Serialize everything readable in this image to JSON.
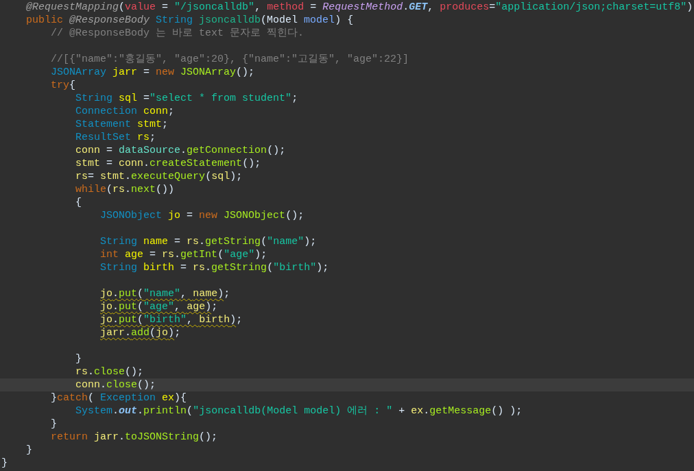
{
  "editor": {
    "lines": [
      {
        "kind": "code",
        "tokens": [
          {
            "text": "\t@RequestMapping",
            "kind": "ann"
          },
          {
            "text": "(",
            "kind": "plain"
          },
          {
            "text": "value",
            "kind": "attr"
          },
          {
            "text": " = ",
            "kind": "plain"
          },
          {
            "text": "\"/jsoncalldb\"",
            "kind": "str"
          },
          {
            "text": ", ",
            "kind": "plain"
          },
          {
            "text": "method",
            "kind": "attr"
          },
          {
            "text": " = ",
            "kind": "plain"
          },
          {
            "text": "RequestMethod",
            "kind": "enum"
          },
          {
            "text": ".",
            "kind": "plain"
          },
          {
            "text": "GET",
            "kind": "const"
          },
          {
            "text": ", ",
            "kind": "plain"
          },
          {
            "text": "produces",
            "kind": "attr"
          },
          {
            "text": "=",
            "kind": "plain"
          },
          {
            "text": "\"application/json;charset=utf8\"",
            "kind": "str"
          },
          {
            "text": ")",
            "kind": "plain"
          }
        ]
      },
      {
        "kind": "code",
        "tokens": [
          {
            "text": "\tpublic ",
            "kind": "kw"
          },
          {
            "text": "@ResponseBody ",
            "kind": "ann"
          },
          {
            "text": "String ",
            "kind": "type"
          },
          {
            "text": "jsoncalldb",
            "kind": "fn"
          },
          {
            "text": "(Model ",
            "kind": "plain"
          },
          {
            "text": "model",
            "kind": "param"
          },
          {
            "text": ") {",
            "kind": "plain"
          }
        ]
      },
      {
        "kind": "code",
        "tokens": [
          {
            "text": "\t\t// @ResponseBody 는 바로 text 문자로 찍힌다.",
            "kind": "cmt"
          }
        ]
      },
      {
        "kind": "blank"
      },
      {
        "kind": "code",
        "tokens": [
          {
            "text": "\t\t//[{\"name\":\"홍길동\", \"age\":20}, {\"name\":\"고길동\", \"age\":22}]",
            "kind": "cmt"
          }
        ]
      },
      {
        "kind": "code",
        "tokens": [
          {
            "text": "\t\tJSONArray ",
            "kind": "type"
          },
          {
            "text": "jarr",
            "kind": "decl"
          },
          {
            "text": " = ",
            "kind": "plain"
          },
          {
            "text": "new ",
            "kind": "kw"
          },
          {
            "text": "JSONArray",
            "kind": "method"
          },
          {
            "text": "();",
            "kind": "plain"
          }
        ]
      },
      {
        "kind": "code",
        "tokens": [
          {
            "text": "\t\ttry",
            "kind": "kw"
          },
          {
            "text": "{",
            "kind": "plain"
          }
        ]
      },
      {
        "kind": "code",
        "tokens": [
          {
            "text": "\t\t\tString ",
            "kind": "type"
          },
          {
            "text": "sql",
            "kind": "decl"
          },
          {
            "text": " =",
            "kind": "plain"
          },
          {
            "text": "\"select * from student\"",
            "kind": "str"
          },
          {
            "text": ";",
            "kind": "plain"
          }
        ]
      },
      {
        "kind": "code",
        "tokens": [
          {
            "text": "\t\t\tConnection ",
            "kind": "type"
          },
          {
            "text": "conn",
            "kind": "decl"
          },
          {
            "text": ";",
            "kind": "plain"
          }
        ]
      },
      {
        "kind": "code",
        "tokens": [
          {
            "text": "\t\t\tStatement ",
            "kind": "type"
          },
          {
            "text": "stmt",
            "kind": "decl"
          },
          {
            "text": ";",
            "kind": "plain"
          }
        ]
      },
      {
        "kind": "code",
        "tokens": [
          {
            "text": "\t\t\tResultSet ",
            "kind": "type"
          },
          {
            "text": "rs",
            "kind": "decl"
          },
          {
            "text": ";",
            "kind": "plain"
          }
        ]
      },
      {
        "kind": "code",
        "tokens": [
          {
            "text": "\t\t\tconn",
            "kind": "var"
          },
          {
            "text": " = ",
            "kind": "plain"
          },
          {
            "text": "dataSource",
            "kind": "field"
          },
          {
            "text": ".",
            "kind": "plain"
          },
          {
            "text": "getConnection",
            "kind": "method"
          },
          {
            "text": "();",
            "kind": "plain"
          }
        ]
      },
      {
        "kind": "code",
        "tokens": [
          {
            "text": "\t\t\tstmt",
            "kind": "var"
          },
          {
            "text": " = ",
            "kind": "plain"
          },
          {
            "text": "conn",
            "kind": "var"
          },
          {
            "text": ".",
            "kind": "plain"
          },
          {
            "text": "createStatement",
            "kind": "method"
          },
          {
            "text": "();",
            "kind": "plain"
          }
        ]
      },
      {
        "kind": "code",
        "tokens": [
          {
            "text": "\t\t\trs",
            "kind": "var"
          },
          {
            "text": "= ",
            "kind": "plain"
          },
          {
            "text": "stmt",
            "kind": "var"
          },
          {
            "text": ".",
            "kind": "plain"
          },
          {
            "text": "executeQuery",
            "kind": "method"
          },
          {
            "text": "(",
            "kind": "plain"
          },
          {
            "text": "sql",
            "kind": "var"
          },
          {
            "text": ");",
            "kind": "plain"
          }
        ]
      },
      {
        "kind": "code",
        "tokens": [
          {
            "text": "\t\t\twhile",
            "kind": "kw"
          },
          {
            "text": "(",
            "kind": "plain"
          },
          {
            "text": "rs",
            "kind": "var"
          },
          {
            "text": ".",
            "kind": "plain"
          },
          {
            "text": "next",
            "kind": "method"
          },
          {
            "text": "())",
            "kind": "plain"
          }
        ]
      },
      {
        "kind": "code",
        "tokens": [
          {
            "text": "\t\t\t{",
            "kind": "plain"
          }
        ]
      },
      {
        "kind": "code",
        "tokens": [
          {
            "text": "\t\t\t\tJSONObject ",
            "kind": "type"
          },
          {
            "text": "jo",
            "kind": "decl"
          },
          {
            "text": " = ",
            "kind": "plain"
          },
          {
            "text": "new ",
            "kind": "kw"
          },
          {
            "text": "JSONObject",
            "kind": "method"
          },
          {
            "text": "();",
            "kind": "plain"
          }
        ]
      },
      {
        "kind": "blank"
      },
      {
        "kind": "code",
        "tokens": [
          {
            "text": "\t\t\t\tString ",
            "kind": "type"
          },
          {
            "text": "name",
            "kind": "decl"
          },
          {
            "text": " = ",
            "kind": "plain"
          },
          {
            "text": "rs",
            "kind": "var"
          },
          {
            "text": ".",
            "kind": "plain"
          },
          {
            "text": "getString",
            "kind": "method"
          },
          {
            "text": "(",
            "kind": "plain"
          },
          {
            "text": "\"name\"",
            "kind": "str"
          },
          {
            "text": ");",
            "kind": "plain"
          }
        ]
      },
      {
        "kind": "code",
        "tokens": [
          {
            "text": "\t\t\t\tint ",
            "kind": "kw"
          },
          {
            "text": "age",
            "kind": "decl"
          },
          {
            "text": " = ",
            "kind": "plain"
          },
          {
            "text": "rs",
            "kind": "var"
          },
          {
            "text": ".",
            "kind": "plain"
          },
          {
            "text": "getInt",
            "kind": "method"
          },
          {
            "text": "(",
            "kind": "plain"
          },
          {
            "text": "\"age\"",
            "kind": "str"
          },
          {
            "text": ");",
            "kind": "plain"
          }
        ]
      },
      {
        "kind": "code",
        "tokens": [
          {
            "text": "\t\t\t\tString ",
            "kind": "type"
          },
          {
            "text": "birth",
            "kind": "decl"
          },
          {
            "text": " = ",
            "kind": "plain"
          },
          {
            "text": "rs",
            "kind": "var"
          },
          {
            "text": ".",
            "kind": "plain"
          },
          {
            "text": "getString",
            "kind": "method"
          },
          {
            "text": "(",
            "kind": "plain"
          },
          {
            "text": "\"birth\"",
            "kind": "str"
          },
          {
            "text": ");",
            "kind": "plain"
          }
        ]
      },
      {
        "kind": "blank"
      },
      {
        "kind": "warning",
        "tokens": [
          {
            "text": "\t\t\t\tjo",
            "kind": "var"
          },
          {
            "text": ".",
            "kind": "plain"
          },
          {
            "text": "put",
            "kind": "method"
          },
          {
            "text": "(",
            "kind": "plain"
          },
          {
            "text": "\"name\"",
            "kind": "str"
          },
          {
            "text": ", ",
            "kind": "plain"
          },
          {
            "text": "name",
            "kind": "var"
          },
          {
            "text": ")",
            "kind": "plain"
          },
          {
            "text": ";",
            "kind": "plain"
          }
        ]
      },
      {
        "kind": "warning",
        "tokens": [
          {
            "text": "\t\t\t\tjo",
            "kind": "var"
          },
          {
            "text": ".",
            "kind": "plain"
          },
          {
            "text": "put",
            "kind": "method"
          },
          {
            "text": "(",
            "kind": "plain"
          },
          {
            "text": "\"age\"",
            "kind": "str"
          },
          {
            "text": ", ",
            "kind": "plain"
          },
          {
            "text": "age",
            "kind": "var"
          },
          {
            "text": ")",
            "kind": "plain"
          },
          {
            "text": ";",
            "kind": "plain"
          }
        ]
      },
      {
        "kind": "warning",
        "tokens": [
          {
            "text": "\t\t\t\tjo",
            "kind": "var"
          },
          {
            "text": ".",
            "kind": "plain"
          },
          {
            "text": "put",
            "kind": "method"
          },
          {
            "text": "(",
            "kind": "plain"
          },
          {
            "text": "\"birth\"",
            "kind": "str"
          },
          {
            "text": ", ",
            "kind": "plain"
          },
          {
            "text": "birth",
            "kind": "var"
          },
          {
            "text": ")",
            "kind": "plain"
          },
          {
            "text": ";",
            "kind": "plain"
          }
        ]
      },
      {
        "kind": "warning",
        "tokens": [
          {
            "text": "\t\t\t\tjarr",
            "kind": "var"
          },
          {
            "text": ".",
            "kind": "plain"
          },
          {
            "text": "add",
            "kind": "method"
          },
          {
            "text": "(",
            "kind": "plain"
          },
          {
            "text": "jo",
            "kind": "var"
          },
          {
            "text": ")",
            "kind": "plain"
          },
          {
            "text": ";",
            "kind": "plain"
          }
        ]
      },
      {
        "kind": "blank"
      },
      {
        "kind": "code",
        "tokens": [
          {
            "text": "\t\t\t}",
            "kind": "plain"
          }
        ]
      },
      {
        "kind": "code",
        "tokens": [
          {
            "text": "\t\t\trs",
            "kind": "var"
          },
          {
            "text": ".",
            "kind": "plain"
          },
          {
            "text": "close",
            "kind": "method"
          },
          {
            "text": "();",
            "kind": "plain"
          }
        ]
      },
      {
        "kind": "current",
        "tokens": [
          {
            "text": "\t\t\tconn",
            "kind": "var"
          },
          {
            "text": ".",
            "kind": "plain"
          },
          {
            "text": "close",
            "kind": "method"
          },
          {
            "text": "();",
            "kind": "plain"
          }
        ]
      },
      {
        "kind": "code",
        "tokens": [
          {
            "text": "\t\t}",
            "kind": "plain"
          },
          {
            "text": "catch",
            "kind": "kw"
          },
          {
            "text": "( ",
            "kind": "plain"
          },
          {
            "text": "Exception ",
            "kind": "type"
          },
          {
            "text": "ex",
            "kind": "decl"
          },
          {
            "text": "){",
            "kind": "plain"
          }
        ]
      },
      {
        "kind": "code",
        "tokens": [
          {
            "text": "\t\t\tSystem",
            "kind": "type"
          },
          {
            "text": ".",
            "kind": "plain"
          },
          {
            "text": "out",
            "kind": "const"
          },
          {
            "text": ".",
            "kind": "plain"
          },
          {
            "text": "println",
            "kind": "method"
          },
          {
            "text": "(",
            "kind": "plain"
          },
          {
            "text": "\"jsoncalldb(Model model) 에러 : \"",
            "kind": "str"
          },
          {
            "text": " + ",
            "kind": "plain"
          },
          {
            "text": "ex",
            "kind": "var"
          },
          {
            "text": ".",
            "kind": "plain"
          },
          {
            "text": "getMessage",
            "kind": "method"
          },
          {
            "text": "() );",
            "kind": "plain"
          }
        ]
      },
      {
        "kind": "code",
        "tokens": [
          {
            "text": "\t\t}",
            "kind": "plain"
          }
        ]
      },
      {
        "kind": "code",
        "tokens": [
          {
            "text": "\t\treturn ",
            "kind": "kw"
          },
          {
            "text": "jarr",
            "kind": "var"
          },
          {
            "text": ".",
            "kind": "plain"
          },
          {
            "text": "toJSONString",
            "kind": "method"
          },
          {
            "text": "();",
            "kind": "plain"
          }
        ]
      },
      {
        "kind": "code",
        "tokens": [
          {
            "text": "\t}",
            "kind": "plain"
          }
        ]
      },
      {
        "kind": "code",
        "tokens": [
          {
            "text": "}",
            "kind": "plain"
          }
        ]
      }
    ]
  }
}
